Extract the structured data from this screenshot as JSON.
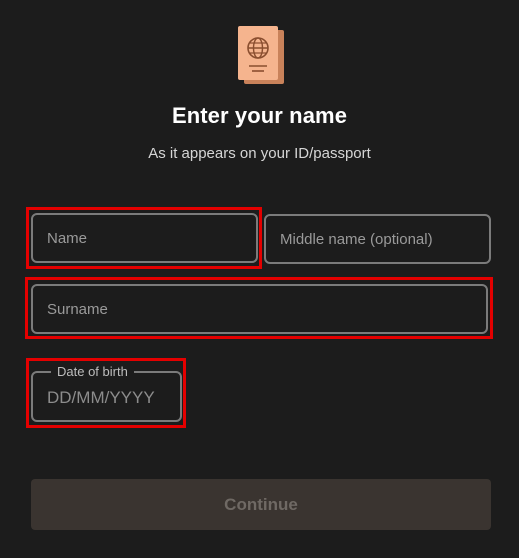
{
  "header": {
    "icon": "passport-icon",
    "title": "Enter your name",
    "subtitle": "As it appears on your ID/passport"
  },
  "form": {
    "name": {
      "placeholder": "Name",
      "value": ""
    },
    "middle_name": {
      "placeholder": "Middle name (optional)",
      "value": ""
    },
    "surname": {
      "placeholder": "Surname",
      "value": ""
    },
    "dob": {
      "label": "Date of birth",
      "placeholder": "DD/MM/YYYY",
      "value": ""
    }
  },
  "actions": {
    "continue_label": "Continue"
  },
  "colors": {
    "background": "#1c1c1c",
    "field_border": "#7b7b7b",
    "highlight": "#e40000",
    "passport_primary": "#f5b48e",
    "passport_shadow": "#c9825a",
    "button_bg": "#3a3430",
    "button_text": "#6f6964"
  }
}
